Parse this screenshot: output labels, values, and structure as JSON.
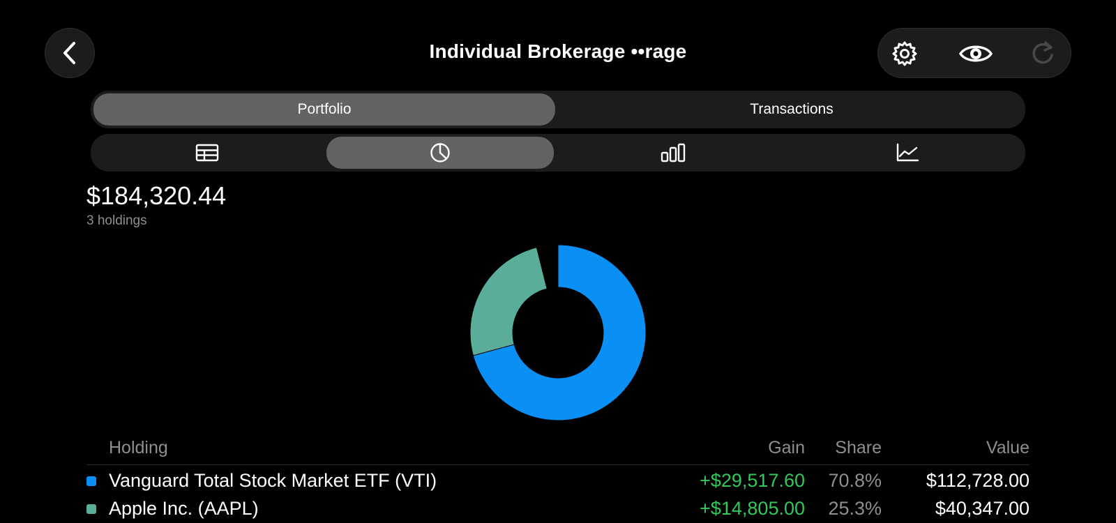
{
  "header": {
    "title": "Individual Brokerage ••rage",
    "back_icon": "chevron-left-icon",
    "tools": [
      {
        "icon": "gear-icon",
        "label": "Settings"
      },
      {
        "icon": "eye-icon",
        "label": "Hide values"
      },
      {
        "icon": "refresh-icon",
        "label": "Refresh"
      }
    ]
  },
  "tabs": [
    {
      "label": "Portfolio",
      "active": true
    },
    {
      "label": "Transactions",
      "active": false
    }
  ],
  "views": [
    {
      "icon": "table-icon",
      "active": false
    },
    {
      "icon": "pie-chart-icon",
      "active": true
    },
    {
      "icon": "bar-chart-icon",
      "active": false
    },
    {
      "icon": "line-chart-icon",
      "active": false
    }
  ],
  "summary": {
    "total_value": "$184,320.44",
    "holdings_count": "3 holdings"
  },
  "table": {
    "columns": [
      "Holding",
      "Gain",
      "Share",
      "Value"
    ],
    "rows": [
      {
        "name": "Vanguard Total Stock Market ETF (VTI)",
        "gain": "+$29,517.60",
        "share": "70.8%",
        "value": "$112,728.00",
        "color": "#0a8ff5"
      },
      {
        "name": "Apple Inc. (AAPL)",
        "gain": "+$14,805.00",
        "share": "25.3%",
        "value": "$40,347.00",
        "color": "#5aad99"
      }
    ]
  },
  "chart_data": {
    "type": "pie",
    "variant": "donut",
    "slices": [
      {
        "label": "Vanguard Total Stock Market ETF (VTI)",
        "share": 70.8,
        "color": "#0a8ff5"
      },
      {
        "label": "Apple Inc. (AAPL)",
        "share": 25.3,
        "color": "#5aad99"
      },
      {
        "label": "",
        "share": 3.9,
        "color": "#000000"
      }
    ]
  },
  "colors": {
    "accent": "#0a8ff5",
    "positive": "#34c759",
    "segment_active": "#636366",
    "segment_bg": "#1c1c1e"
  }
}
